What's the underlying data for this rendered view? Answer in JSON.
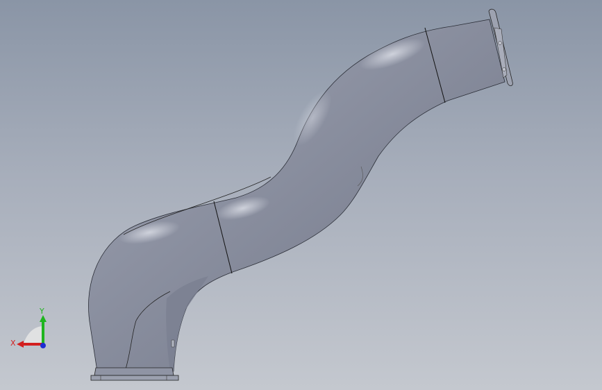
{
  "view": {
    "background_top": "#8a95a6",
    "background_bottom": "#c4c8cf"
  },
  "model": {
    "pipe_color": "#8e93a3",
    "pipe_highlight": "#c9ccd6",
    "pipe_shadow": "#6e7384",
    "edge_color": "#1a1a1a"
  },
  "triad": {
    "x_label": "X",
    "y_label": "Y",
    "x_color": "#d21f1f",
    "y_color": "#1fb51f",
    "z_color": "#1f2fd2"
  }
}
